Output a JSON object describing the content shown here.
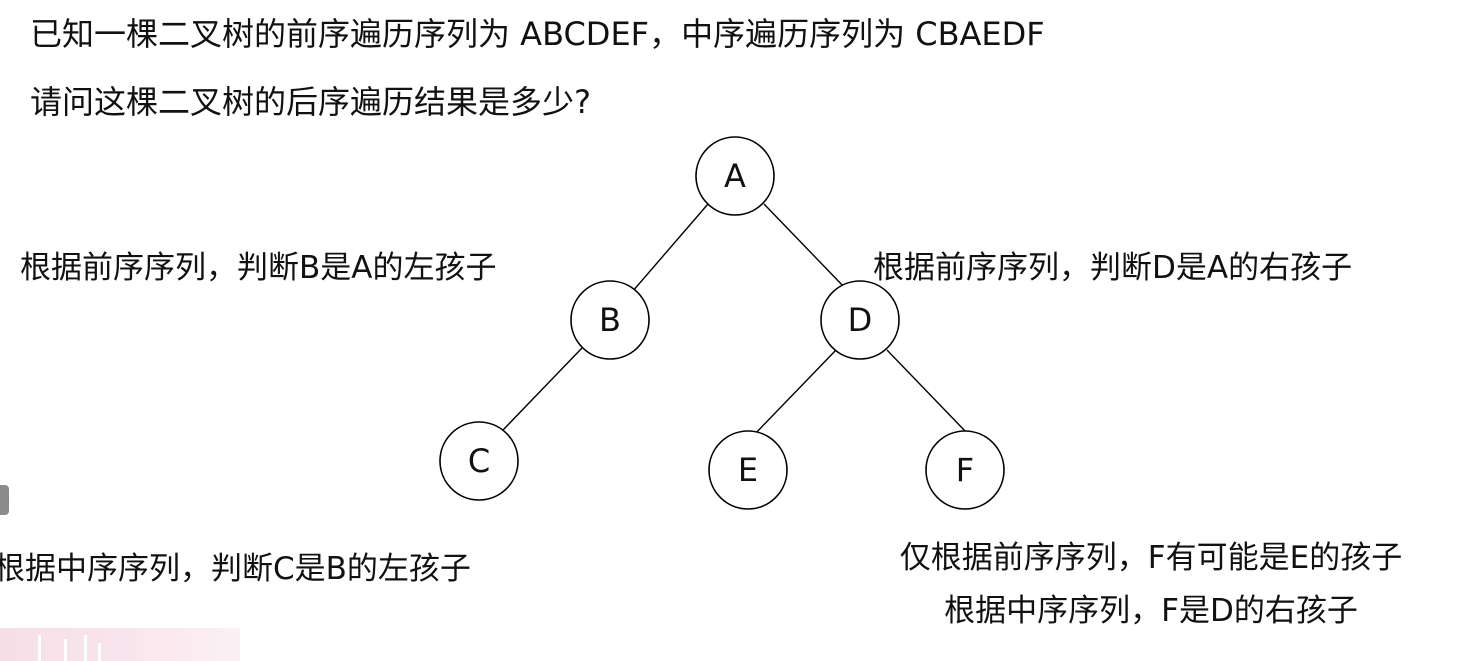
{
  "question": {
    "line1": "已知一棵二叉树的前序遍历序列为 ABCDEF，中序遍历序列为 CBAEDF",
    "line2": "请问这棵二叉树的后序遍历结果是多少?"
  },
  "tree": {
    "nodes": {
      "A": "A",
      "B": "B",
      "C": "C",
      "D": "D",
      "E": "E",
      "F": "F"
    }
  },
  "annotations": {
    "b_left_child": "根据前序序列，判断B是A的左孩子",
    "d_right_child": "根据前序序列，判断D是A的右孩子",
    "c_left_child": "根据中序序列，判断C是B的左孩子",
    "f_note_line1": "仅根据前序序列，F有可能是E的孩子",
    "f_note_line2": "根据中序序列，F是D的右孩子"
  }
}
